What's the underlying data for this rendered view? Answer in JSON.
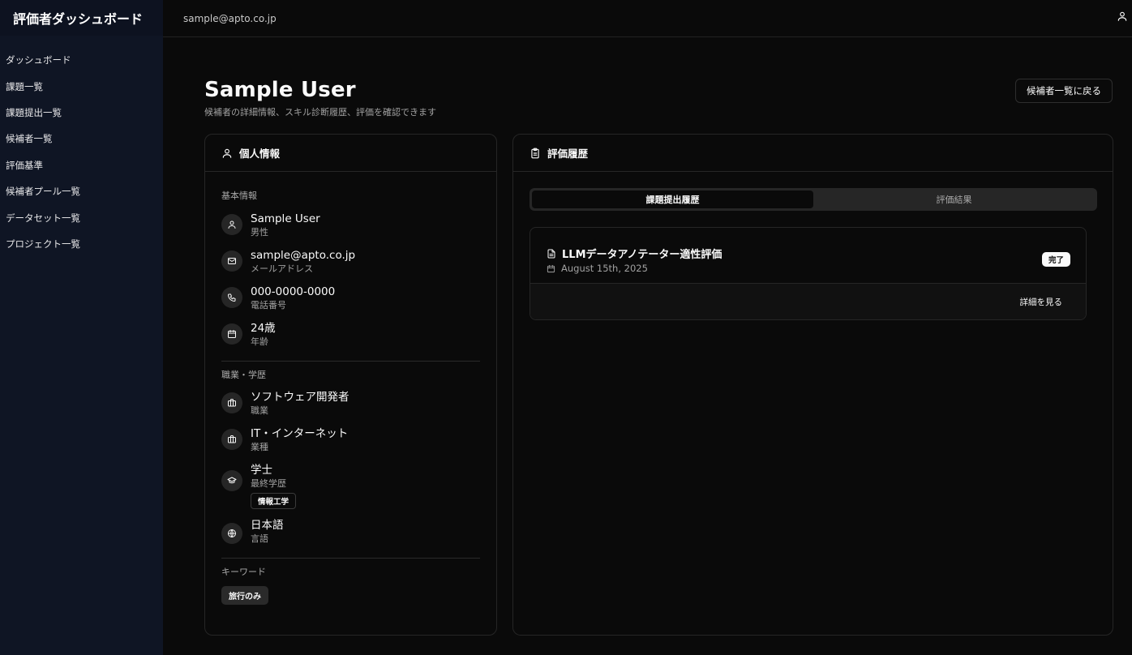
{
  "sidebar": {
    "title": "評価者ダッシュボード",
    "items": [
      {
        "label": "ダッシュボード"
      },
      {
        "label": "課題一覧"
      },
      {
        "label": "課題提出一覧"
      },
      {
        "label": "候補者一覧"
      },
      {
        "label": "評価基準"
      },
      {
        "label": "候補者プール一覧"
      },
      {
        "label": "データセット一覧"
      },
      {
        "label": "プロジェクト一覧"
      }
    ]
  },
  "topbar": {
    "email": "sample@apto.co.jp",
    "user_icon": "user-icon"
  },
  "page": {
    "title": "Sample User",
    "subtitle": "候補者の詳細情報、スキル診断履歴、評価を確認できます",
    "back_button": "候補者一覧に戻る"
  },
  "personal": {
    "header": "個人情報",
    "basic_label": "基本情報",
    "basic": [
      {
        "icon": "user-icon",
        "value": "Sample User",
        "label": "男性"
      },
      {
        "icon": "mail-icon",
        "value": "sample@apto.co.jp",
        "label": "メールアドレス"
      },
      {
        "icon": "phone-icon",
        "value": "000-0000-0000",
        "label": "電話番号"
      },
      {
        "icon": "calendar-icon",
        "value": "24歳",
        "label": "年齢"
      }
    ],
    "career_label": "職業・学歴",
    "career": [
      {
        "icon": "briefcase-icon",
        "value": "ソフトウェア開発者",
        "label": "職業"
      },
      {
        "icon": "briefcase-icon",
        "value": "IT・インターネット",
        "label": "業種"
      },
      {
        "icon": "graduation-cap-icon",
        "value": "学士",
        "label": "最終学歴",
        "tag": "情報工学"
      },
      {
        "icon": "globe-icon",
        "value": "日本語",
        "label": "言語"
      }
    ],
    "keyword_label": "キーワード",
    "keywords": [
      "旅行のみ"
    ]
  },
  "history": {
    "header": "評価履歴",
    "tabs": [
      {
        "label": "課題提出履歴",
        "active": true
      },
      {
        "label": "評価結果",
        "active": false
      }
    ],
    "submissions": [
      {
        "title": "LLMデータアノテーター適性評価",
        "date": "August 15th, 2025",
        "status": "完了",
        "detail_link": "詳細を見る"
      }
    ]
  },
  "colors": {
    "background": "#0a0a0a",
    "sidebar": "#0f1524",
    "border": "#262626",
    "text": "#fafafa",
    "muted": "#a1a1a1"
  }
}
